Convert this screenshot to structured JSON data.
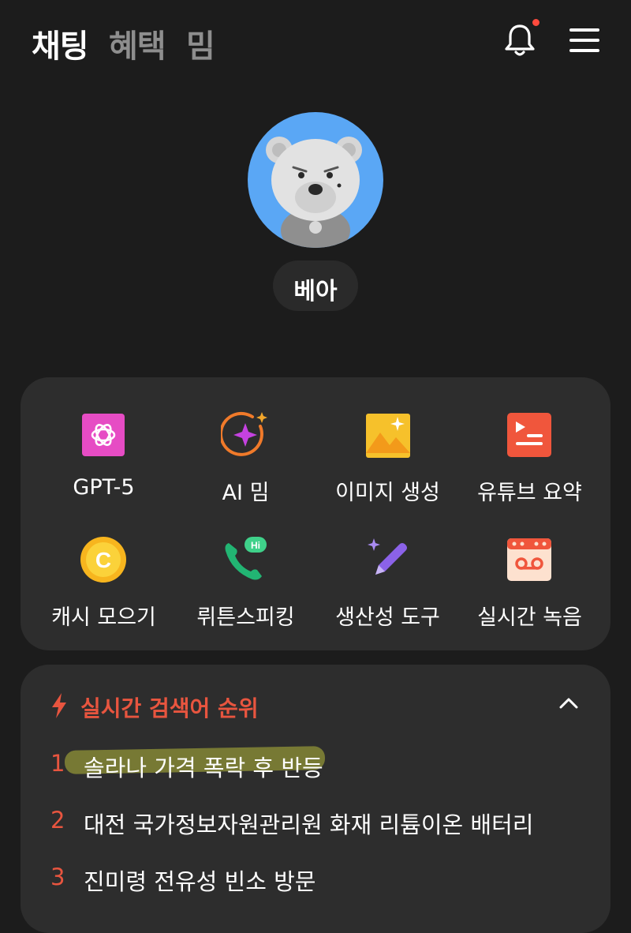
{
  "header": {
    "tabs": [
      {
        "label": "채팅",
        "active": true
      },
      {
        "label": "혜택",
        "active": false
      },
      {
        "label": "밈",
        "active": false
      }
    ],
    "notification_icon": "bell-icon",
    "menu_icon": "hamburger-menu-icon"
  },
  "profile": {
    "name": "베아",
    "avatar": "bear-avatar"
  },
  "features": [
    {
      "label": "GPT-5",
      "icon": "gpt-icon"
    },
    {
      "label": "AI 밈",
      "icon": "sparkle-icon"
    },
    {
      "label": "이미지 생성",
      "icon": "image-icon"
    },
    {
      "label": "유튜브 요약",
      "icon": "youtube-summary-icon"
    },
    {
      "label": "캐시 모으기",
      "icon": "coin-icon"
    },
    {
      "label": "뤼튼스피킹",
      "icon": "phone-hi-icon"
    },
    {
      "label": "생산성 도구",
      "icon": "pen-sparkle-icon"
    },
    {
      "label": "실시간 녹음",
      "icon": "recorder-icon"
    }
  ],
  "trending": {
    "title": "실시간 검색어 순위",
    "items": [
      {
        "rank": "1",
        "text": "솔라나 가격 폭락 후 반등"
      },
      {
        "rank": "2",
        "text": "대전 국가정보자원관리원 화재 리튬이온 배터리"
      },
      {
        "rank": "3",
        "text": "진미령 전유성 빈소 방문"
      }
    ]
  },
  "colors": {
    "background": "#1c1c1c",
    "card": "#2d2d2d",
    "accent": "#e8553f",
    "highlight": "#b4b83a"
  }
}
